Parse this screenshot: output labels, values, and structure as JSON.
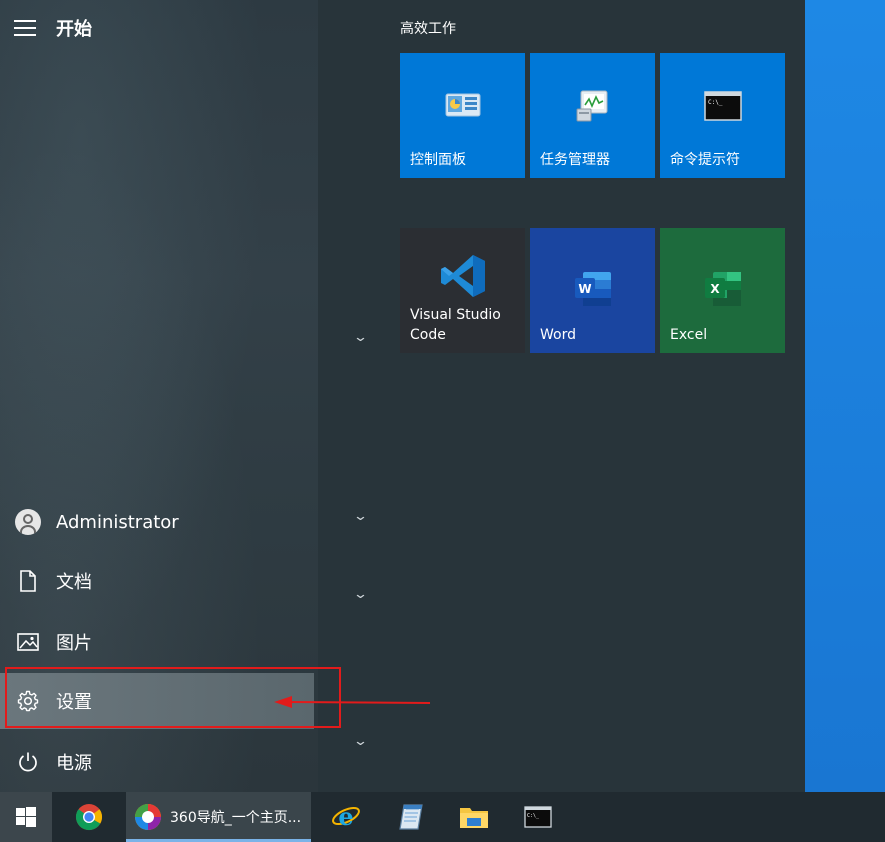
{
  "start_menu": {
    "title": "开始",
    "user": {
      "name": "Administrator"
    },
    "nav": {
      "documents": "文档",
      "pictures": "图片",
      "settings": "设置",
      "power": "电源"
    }
  },
  "tiles": {
    "group_title": "高效工作",
    "items": [
      {
        "label": "控制面板",
        "color": "#0078d7"
      },
      {
        "label": "任务管理器",
        "color": "#0078d7"
      },
      {
        "label": "命令提示符",
        "color": "#0078d7"
      },
      {
        "label": "Visual Studio\nCode",
        "color": "#2b2e33"
      },
      {
        "label": "Word",
        "color": "#1a45a0"
      },
      {
        "label": "Excel",
        "color": "#1d6b3d"
      }
    ]
  },
  "taskbar": {
    "items": [
      {
        "icon": "windows-start-icon"
      },
      {
        "icon": "chrome-icon"
      },
      {
        "icon": "360-browser-icon",
        "label": "360导航_一个主页..."
      },
      {
        "icon": "internet-explorer-icon"
      },
      {
        "icon": "notepad-icon"
      },
      {
        "icon": "file-explorer-icon"
      },
      {
        "icon": "command-prompt-icon"
      }
    ]
  },
  "annotation_color": "#e21b1b"
}
